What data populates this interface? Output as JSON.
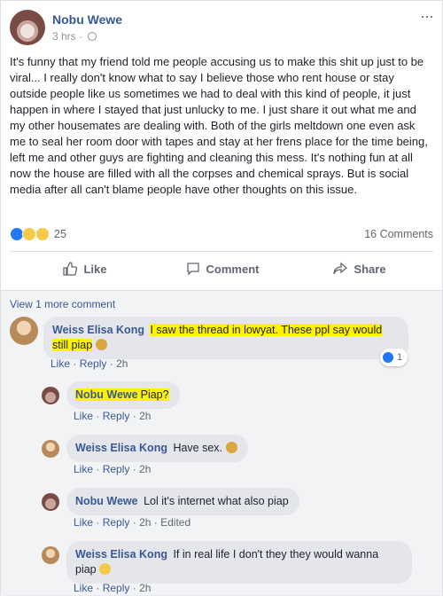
{
  "post": {
    "author": "Nobu Wewe",
    "time": "3 hrs",
    "separator": "·",
    "more_label": "···",
    "text": "It's funny that my friend told me people accusing us to make this shit up just to be viral... I really don't know what to say I believe those who rent house or stay outside people like us sometimes we had to deal with this kind of people, it just happen in where I stayed that just unlucky to me. I just share it out what me and my other housemates are dealing with. Both of the girls meltdown one even ask me to seal her room door with tapes and stay at her frens place for the time being, left me and other guys are fighting and cleaning this mess. It's nothing fun at all now the house are filled with all the corpses and chemical sprays. But is social media after all can't blame people have other thoughts on this issue.",
    "reaction_count": "25",
    "comments_count": "16 Comments",
    "reaction_icons": [
      "like-icon",
      "sad-icon",
      "haha-icon"
    ]
  },
  "actions": {
    "like": "Like",
    "comment": "Comment",
    "share": "Share"
  },
  "comments_section": {
    "view_more": "View 1 more comment",
    "comments": [
      {
        "author": "Weiss Elisa Kong",
        "text": "I saw the thread in lowyat. These ppl say would still piap",
        "like": "Like",
        "reply": "Reply",
        "sep": "·",
        "time": "2h",
        "reaction_count": "1"
      },
      {
        "author": "Nobu Wewe",
        "text": "Piap?",
        "like": "Like",
        "reply": "Reply",
        "sep": "·",
        "time": "2h"
      },
      {
        "author": "Weiss Elisa Kong",
        "text": "Have sex.",
        "like": "Like",
        "reply": "Reply",
        "sep": "·",
        "time": "2h"
      },
      {
        "author": "Nobu Wewe",
        "text": "Lol it's internet what also piap",
        "like": "Like",
        "reply": "Reply",
        "sep": "·",
        "time": "2h",
        "edited": "Edited"
      },
      {
        "author": "Weiss Elisa Kong",
        "text": "If in real life I don't they they would wanna piap",
        "like": "Like",
        "reply": "Reply",
        "sep": "·",
        "time": "2h"
      }
    ]
  },
  "colors": {
    "link_blue": "#385898",
    "highlight": "#fff200",
    "like_blue": "#2078f4"
  }
}
